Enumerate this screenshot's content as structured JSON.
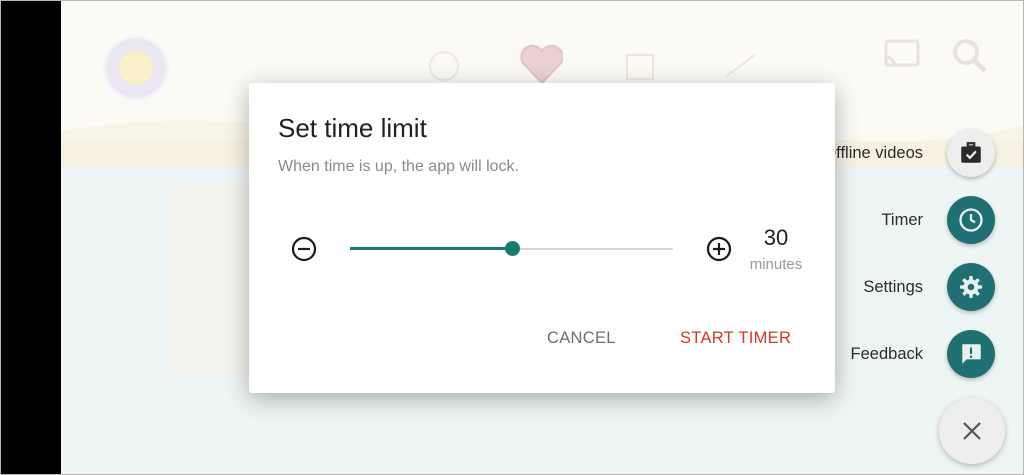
{
  "dialog": {
    "title": "Set time limit",
    "subtitle": "When time is up, the app will lock.",
    "slider_fraction": 0.5,
    "value": "30",
    "unit": "minutes",
    "cancel_label": "CANCEL",
    "start_label": "START TIMER"
  },
  "fab_menu": {
    "items": [
      {
        "label": "Offline videos",
        "icon": "briefcase-check-icon"
      },
      {
        "label": "Timer",
        "icon": "clock-icon"
      },
      {
        "label": "Settings",
        "icon": "gear-icon"
      },
      {
        "label": "Feedback",
        "icon": "feedback-icon"
      }
    ],
    "close_icon": "close-icon"
  },
  "colors": {
    "accent": "#197b70",
    "fab_teal": "#1f6f73",
    "start_timer": "#d33a26"
  }
}
